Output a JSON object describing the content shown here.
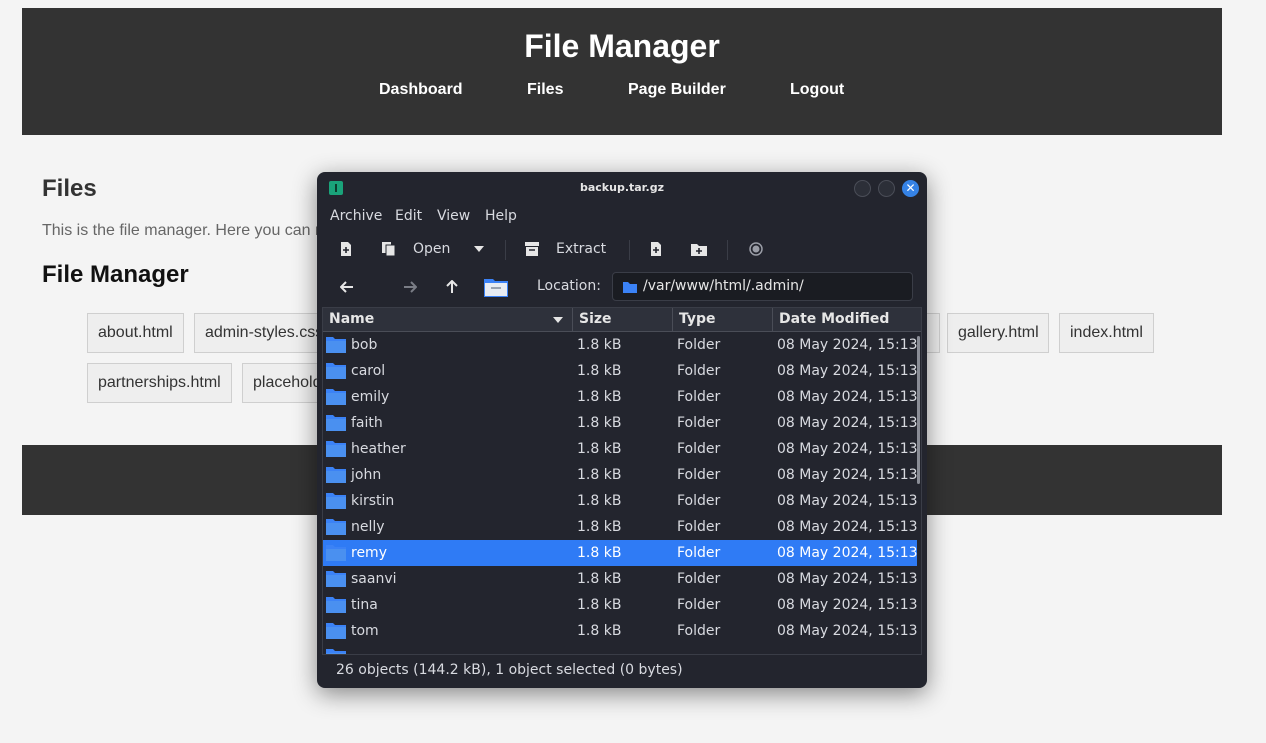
{
  "site": {
    "title": "File Manager",
    "nav": [
      "Dashboard",
      "Files",
      "Page Builder",
      "Logout"
    ],
    "section_title": "Files",
    "description": "This is the file manager. Here you can m",
    "manager_title": "File Manager",
    "chips_row1": [
      "about.html",
      "admin-styles.css",
      "",
      "gallery.html",
      "index.html"
    ],
    "chips_row2": [
      "partnerships.html",
      "placehold"
    ]
  },
  "window": {
    "title": "backup.tar.gz",
    "menu": [
      "Archive",
      "Edit",
      "View",
      "Help"
    ],
    "toolbar": {
      "open_label": "Open",
      "extract_label": "Extract"
    },
    "location_label": "Location:",
    "location_path": "/var/www/html/.admin/",
    "columns": [
      "Name",
      "Size",
      "Type",
      "Date Modified"
    ],
    "rows": [
      {
        "name": "bob",
        "size": "1.8 kB",
        "type": "Folder",
        "date": "08 May 2024, 15:13"
      },
      {
        "name": "carol",
        "size": "1.8 kB",
        "type": "Folder",
        "date": "08 May 2024, 15:13"
      },
      {
        "name": "emily",
        "size": "1.8 kB",
        "type": "Folder",
        "date": "08 May 2024, 15:13"
      },
      {
        "name": "faith",
        "size": "1.8 kB",
        "type": "Folder",
        "date": "08 May 2024, 15:13"
      },
      {
        "name": "heather",
        "size": "1.8 kB",
        "type": "Folder",
        "date": "08 May 2024, 15:13"
      },
      {
        "name": "john",
        "size": "1.8 kB",
        "type": "Folder",
        "date": "08 May 2024, 15:13"
      },
      {
        "name": "kirstin",
        "size": "1.8 kB",
        "type": "Folder",
        "date": "08 May 2024, 15:13"
      },
      {
        "name": "nelly",
        "size": "1.8 kB",
        "type": "Folder",
        "date": "08 May 2024, 15:13"
      },
      {
        "name": "remy",
        "size": "1.8 kB",
        "type": "Folder",
        "date": "08 May 2024, 15:13"
      },
      {
        "name": "saanvi",
        "size": "1.8 kB",
        "type": "Folder",
        "date": "08 May 2024, 15:13"
      },
      {
        "name": "tina",
        "size": "1.8 kB",
        "type": "Folder",
        "date": "08 May 2024, 15:13"
      },
      {
        "name": "tom",
        "size": "1.8 kB",
        "type": "Folder",
        "date": "08 May 2024, 15:13"
      }
    ],
    "selected_row": "remy",
    "status": "26 objects (144.2 kB), 1 object selected (0 bytes)"
  },
  "colors": {
    "accent": "#2f7bf5",
    "folder": "#3b82f6",
    "header_bg": "#333333",
    "window_bg": "#23252e"
  }
}
